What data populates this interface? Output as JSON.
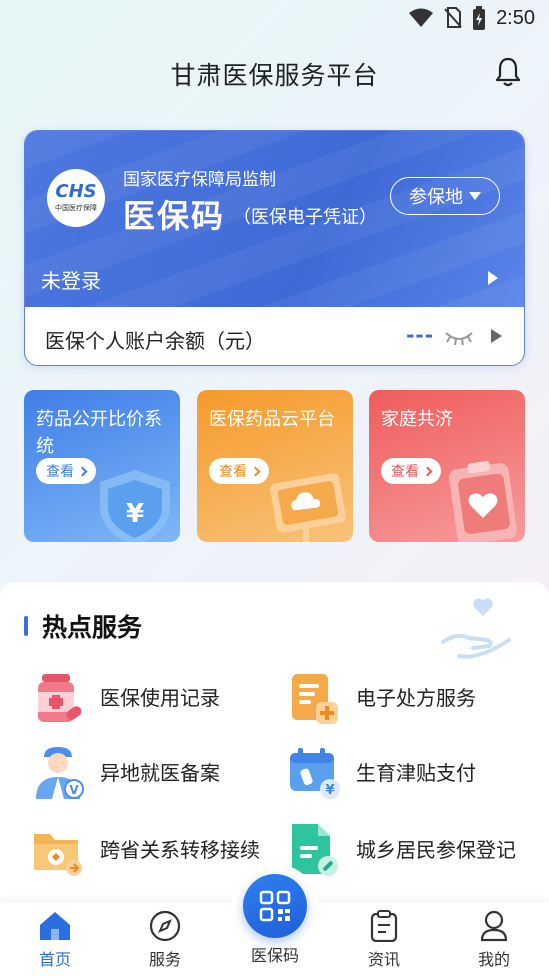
{
  "status_bar": {
    "time": "2:50",
    "icons": [
      "wifi-icon",
      "no-sim-icon",
      "battery-charging-icon"
    ]
  },
  "header": {
    "title": "甘肃医保服务平台",
    "icon": "bell-icon"
  },
  "card": {
    "logo_text": "CHS",
    "logo_sub": "中国医疗保障",
    "supervise": "国家医疗保障局监制",
    "title": "医保码",
    "subtitle": "（医保电子凭证）",
    "insure_place_button": "参保地",
    "login_status": "未登录",
    "balance_label": "医保个人账户余额（元）",
    "balance_value": "---"
  },
  "tiles": [
    {
      "title": "药品公开比价系统",
      "button": "查看",
      "icon": "yuan-shield-icon"
    },
    {
      "title": "医保药品云平台",
      "button": "查看",
      "icon": "cloud-monitor-icon"
    },
    {
      "title": "家庭共济",
      "button": "查看",
      "icon": "heart-card-icon"
    }
  ],
  "hot_services": {
    "title": "热点服务",
    "items": [
      {
        "label": "医保使用记录",
        "icon": "medicine-bottle-icon"
      },
      {
        "label": "电子处方服务",
        "icon": "prescription-icon"
      },
      {
        "label": "异地就医备案",
        "icon": "doctor-icon"
      },
      {
        "label": "生育津贴支付",
        "icon": "calendar-bottle-icon"
      },
      {
        "label": "跨省关系转移接续",
        "icon": "transfer-folder-icon"
      },
      {
        "label": "城乡居民参保登记",
        "icon": "document-pen-icon"
      }
    ]
  },
  "bottom_nav": {
    "items": [
      {
        "label": "首页",
        "icon": "home-icon",
        "active": true
      },
      {
        "label": "服务",
        "icon": "compass-icon"
      },
      {
        "label": "医保码",
        "icon": "qr-code-icon"
      },
      {
        "label": "资讯",
        "icon": "clipboard-icon"
      },
      {
        "label": "我的",
        "icon": "user-icon"
      }
    ]
  },
  "colors": {
    "primary": "#3f6ad6",
    "orange": "#f59a2a",
    "red": "#ef5c5c",
    "active_nav": "#2a6ee0"
  }
}
